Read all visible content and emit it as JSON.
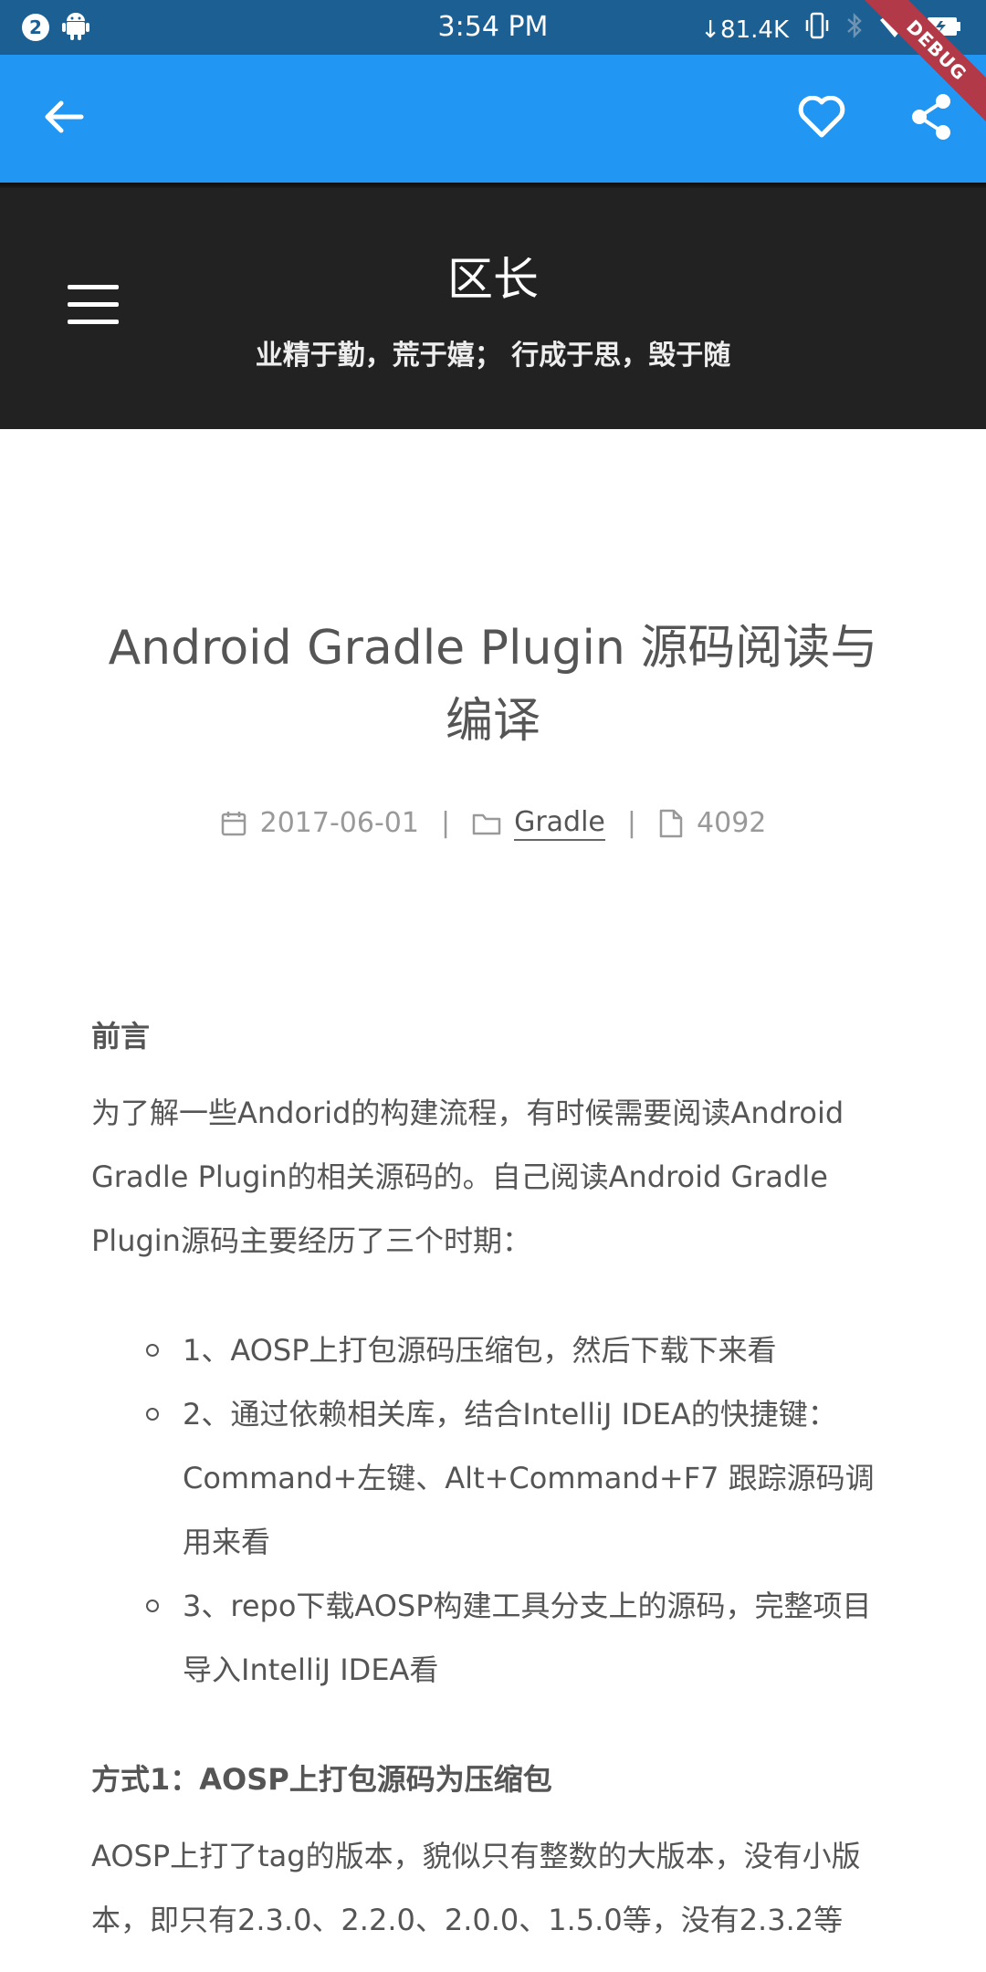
{
  "status_bar": {
    "notification_count": "2",
    "time": "3:54 PM",
    "network_speed": "↓81.4K",
    "debug_label": "DEBUG"
  },
  "app_bar": {
    "icons": [
      "arrow-back-icon",
      "heart-icon",
      "share-icon"
    ]
  },
  "site_header": {
    "title": "区长",
    "subtitle": "业精于勤，荒于嬉； 行成于思，毁于随"
  },
  "post": {
    "title": "Android Gradle Plugin 源码阅读与编译",
    "date": "2017-06-01",
    "category": "Gradle",
    "word_count": "4092",
    "meta_separator": "|"
  },
  "content": {
    "preface_heading": "前言",
    "preface_text": "为了解一些Andorid的构建流程，有时候需要阅读Android Gradle Plugin的相关源码的。自己阅读Android Gradle Plugin源码主要经历了三个时期：",
    "list_items": [
      "1、AOSP上打包源码压缩包，然后下载下来看",
      "2、通过依赖相关库，结合IntelliJ IDEA的快捷键：Command+左键、Alt+Command+F7 跟踪源码调用来看",
      "3、repo下载AOSP构建工具分支上的源码，完整项目导入IntelliJ IDEA看"
    ],
    "method1_heading": "方式1：AOSP上打包源码为压缩包",
    "method1_text": "AOSP上打了tag的版本，貌似只有整数的大版本，没有小版本，即只有2.3.0、2.2.0、2.0.0、1.5.0等，没有2.3.2等"
  },
  "colors": {
    "status_bar": "#1b5f93",
    "app_bar": "#2196f3",
    "header_bg": "#222222",
    "text": "#555555",
    "meta": "#999999"
  }
}
